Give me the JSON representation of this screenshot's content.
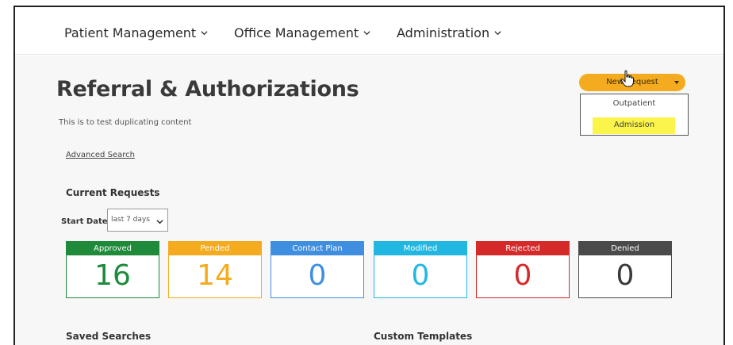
{
  "nav": {
    "items": [
      {
        "label": "Patient Management"
      },
      {
        "label": "Office Management"
      },
      {
        "label": "Administration"
      }
    ]
  },
  "page": {
    "title": "Referral & Authorizations",
    "description": "This is to test duplicating content",
    "advanced_search": "Advanced Search"
  },
  "current_requests": {
    "title": "Current Requests",
    "start_date_label": "Start Date",
    "start_date_value": "last 7 days",
    "cards": [
      {
        "label": "Approved",
        "count": "16",
        "color": "#1e8a3a"
      },
      {
        "label": "Pended",
        "count": "14",
        "color": "#f5ab1f"
      },
      {
        "label": "Contact Plan",
        "count": "0",
        "color": "#3f8ee0"
      },
      {
        "label": "Modified",
        "count": "0",
        "color": "#22b7e0"
      },
      {
        "label": "Rejected",
        "count": "0",
        "color": "#d42a2a"
      },
      {
        "label": "Denied",
        "count": "0",
        "color": "#4a4a4a"
      }
    ]
  },
  "new_request": {
    "label": "New Request",
    "options": [
      "Outpatient",
      "Admission"
    ],
    "highlighted": "Admission"
  },
  "bottom": {
    "saved_searches": "Saved Searches",
    "custom_templates": "Custom Templates"
  },
  "colors": {
    "accent": "#f5ab1f",
    "highlight": "#fbf44a",
    "background": "#f7f7f7"
  }
}
